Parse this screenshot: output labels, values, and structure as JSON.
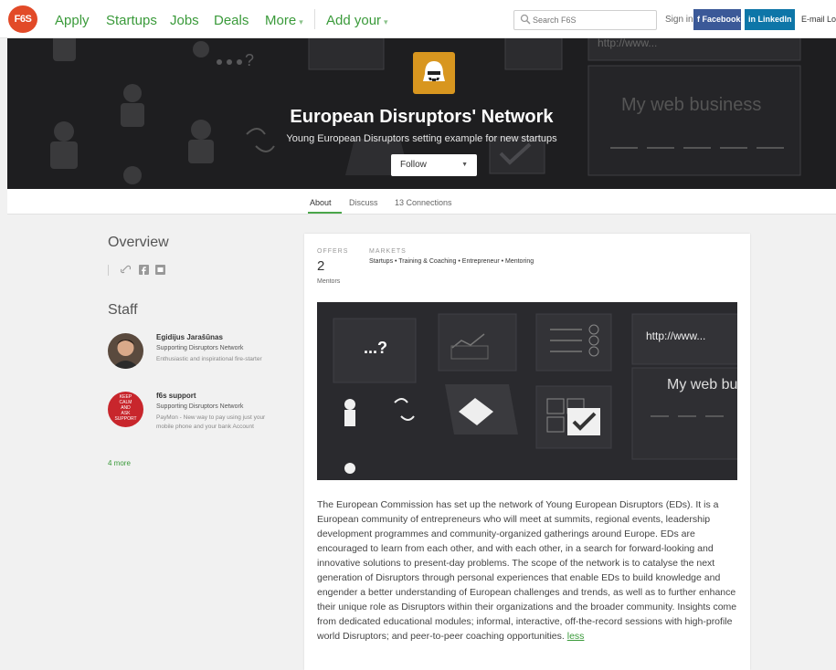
{
  "nav": {
    "logo": "F6S",
    "links": [
      {
        "label": "Apply"
      },
      {
        "label": "Startups"
      },
      {
        "label": "Jobs"
      },
      {
        "label": "Deals"
      },
      {
        "label": "More",
        "caret": "▾"
      },
      {
        "label": "Add your",
        "caret": "▾"
      }
    ],
    "search_placeholder": "Search F6S",
    "signin": "Sign in",
    "facebook": "f Facebook",
    "linkedin": "in LinkedIn",
    "email": "E-mail Log"
  },
  "hero": {
    "title": "European Disruptors' Network",
    "subtitle": "Young European Disruptors setting example for new startups",
    "follow_label": "Follow",
    "bg_text_1": "My web business",
    "bg_text_2": "http://www..."
  },
  "tabs": [
    {
      "label": "About"
    },
    {
      "label": "Discuss"
    },
    {
      "label": "13 Connections"
    }
  ],
  "overview": {
    "title": "Overview",
    "icons": [
      "link-icon",
      "facebook-icon",
      "twitter-icon"
    ]
  },
  "staff": {
    "title": "Staff",
    "members": [
      {
        "name": "Egidijus Jarašūnas",
        "role": "Supporting Disruptors Network",
        "desc": "Enthusiastic and inspirational fire-starter"
      },
      {
        "name": "f6s support",
        "role": "Supporting Disruptors Network",
        "desc": "PayMon - New way to pay using just your mobile phone and your bank Account",
        "photo_text": [
          "KEEP",
          "CALM",
          "AND",
          "ASK",
          "SUPPORT"
        ]
      }
    ],
    "more": "4 more"
  },
  "card": {
    "offers_label": "OFFERS",
    "offers_count": "2",
    "offers_sub": "Mentors",
    "markets_label": "MARKETS",
    "markets": "Startups • Training & Coaching • Entrepreneur • Mentoring",
    "image_text_1": "...?",
    "image_text_2": "http://www...",
    "image_text_3": "My web bu",
    "description": "The European Commission has set up the network of Young European Disruptors (EDs). It is a European community of entrepreneurs who will meet at summits, regional events, leadership development programmes and community-organized gatherings around Europe. EDs are encouraged to learn from each other, and with each other, in a search for forward-looking and innovative solutions to present-day problems. The scope of the network is to catalyse the next generation of Disruptors through personal experiences that enable EDs to build knowledge and engender a better understanding of European challenges and trends, as well as to further enhance their unique role as Disruptors within their organizations and the broader community. Insights come from dedicated educational modules; informal, interactive, off-the-record sessions with high-profile world Disruptors; and peer-to-peer coaching opportunities.",
    "less": "less"
  },
  "colors": {
    "accent_green": "#3a9a3a",
    "logo_red": "#e24a28",
    "facebook_blue": "#3b5998",
    "linkedin_blue": "#0e76a8",
    "hero_bg": "#1e1e20",
    "avatar_orange": "#d8961f"
  }
}
